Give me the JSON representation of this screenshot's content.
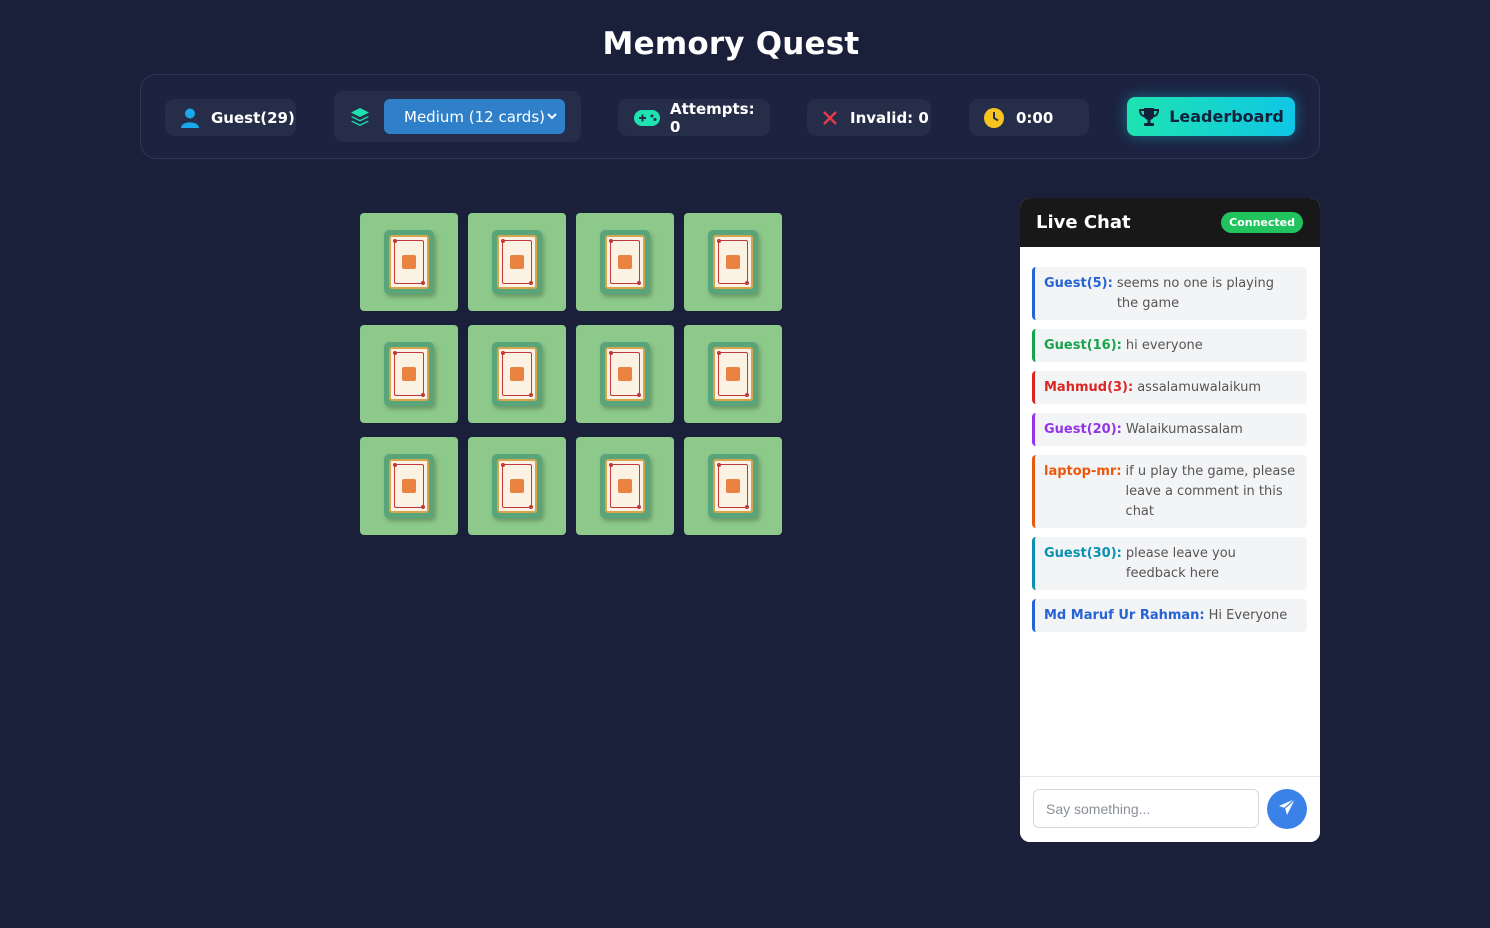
{
  "header": {
    "title": "Memory Quest"
  },
  "toolbar": {
    "user": {
      "label": "Guest(29)",
      "icon": "user-icon",
      "color": "#1aa7ec"
    },
    "difficulty": {
      "selected": "Medium (12 cards)",
      "icon": "layers-icon",
      "color": "#1ee3b0"
    },
    "attempts": {
      "label": "Attempts: 0",
      "icon": "gamepad-icon",
      "color": "#1ee3b0"
    },
    "invalid": {
      "label": "Invalid: 0",
      "icon": "close-icon",
      "color": "#e8394a"
    },
    "timer": {
      "label": "0:00",
      "icon": "clock-icon",
      "color": "#f7c521"
    },
    "leaderboard": {
      "label": "Leaderboard",
      "icon": "trophy-icon"
    }
  },
  "board": {
    "cards": [
      {
        "state": "face-down"
      },
      {
        "state": "face-down"
      },
      {
        "state": "face-down"
      },
      {
        "state": "face-down"
      },
      {
        "state": "face-down"
      },
      {
        "state": "face-down"
      },
      {
        "state": "face-down"
      },
      {
        "state": "face-down"
      },
      {
        "state": "face-down"
      },
      {
        "state": "face-down"
      },
      {
        "state": "face-down"
      },
      {
        "state": "face-down"
      }
    ]
  },
  "chat": {
    "title": "Live Chat",
    "status": "Connected",
    "messages": [
      {
        "user": "Guest(5):",
        "text": "seems no one is playing the game",
        "color": "#2563d6"
      },
      {
        "user": "Guest(16):",
        "text": "hi everyone",
        "color": "#16a34a"
      },
      {
        "user": "Mahmud(3):",
        "text": "assalamuwalaikum",
        "color": "#dc2626"
      },
      {
        "user": "Guest(20):",
        "text": "Walaikumassalam",
        "color": "#9333ea"
      },
      {
        "user": "laptop-mr:",
        "text": "if u play the game, please leave a comment in this chat",
        "color": "#ea580c"
      },
      {
        "user": "Guest(30):",
        "text": "please leave you feedback here",
        "color": "#0891b2"
      },
      {
        "user": "Md Maruf Ur Rahman:",
        "text": "Hi Everyone",
        "color": "#2563d6"
      }
    ],
    "input": {
      "placeholder": "Say something...",
      "value": ""
    },
    "send_icon": "send-icon"
  }
}
